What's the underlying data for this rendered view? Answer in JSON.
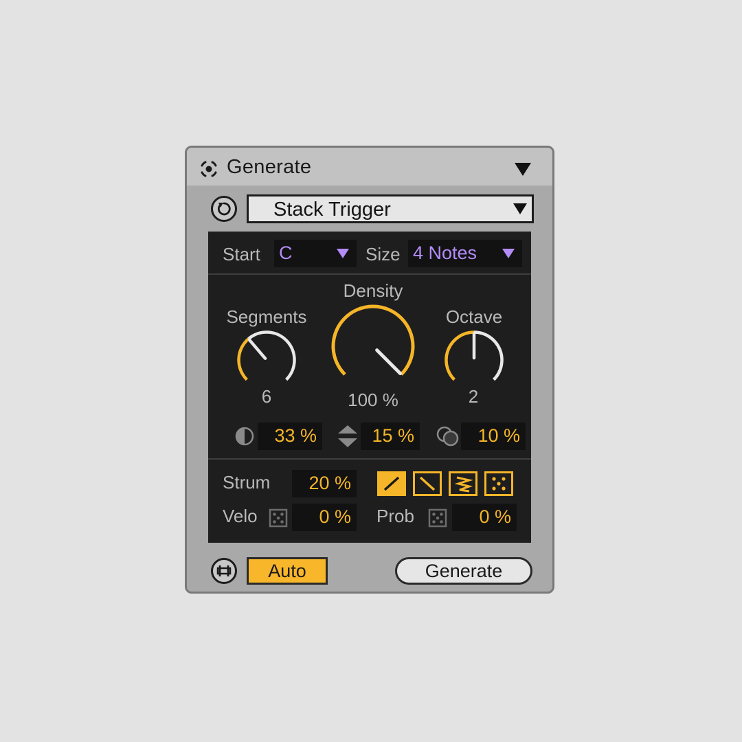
{
  "device": {
    "title": "Generate",
    "preset": "Stack Trigger"
  },
  "top_row": {
    "start_label": "Start",
    "start_value": "C",
    "size_label": "Size",
    "size_value": "4 Notes"
  },
  "knobs": {
    "segments": {
      "label": "Segments",
      "value": "6",
      "fraction": 0.35
    },
    "density": {
      "label": "Density",
      "value": "100 %",
      "fraction": 1.0
    },
    "octave": {
      "label": "Octave",
      "value": "2",
      "fraction": 0.5
    }
  },
  "params": {
    "p1": "33 %",
    "p2": "15 %",
    "p3": "10 %"
  },
  "bottom": {
    "strum_label": "Strum",
    "strum_value": "20 %",
    "velo_label": "Velo",
    "velo_value": "0 %",
    "prob_label": "Prob",
    "prob_value": "0 %"
  },
  "footer": {
    "auto_label": "Auto",
    "generate_label": "Generate"
  },
  "colors": {
    "accent": "#f5b528",
    "purple": "#b38cf8",
    "panel": "#1e1e1e",
    "knob_track": "#e8e8e8"
  }
}
